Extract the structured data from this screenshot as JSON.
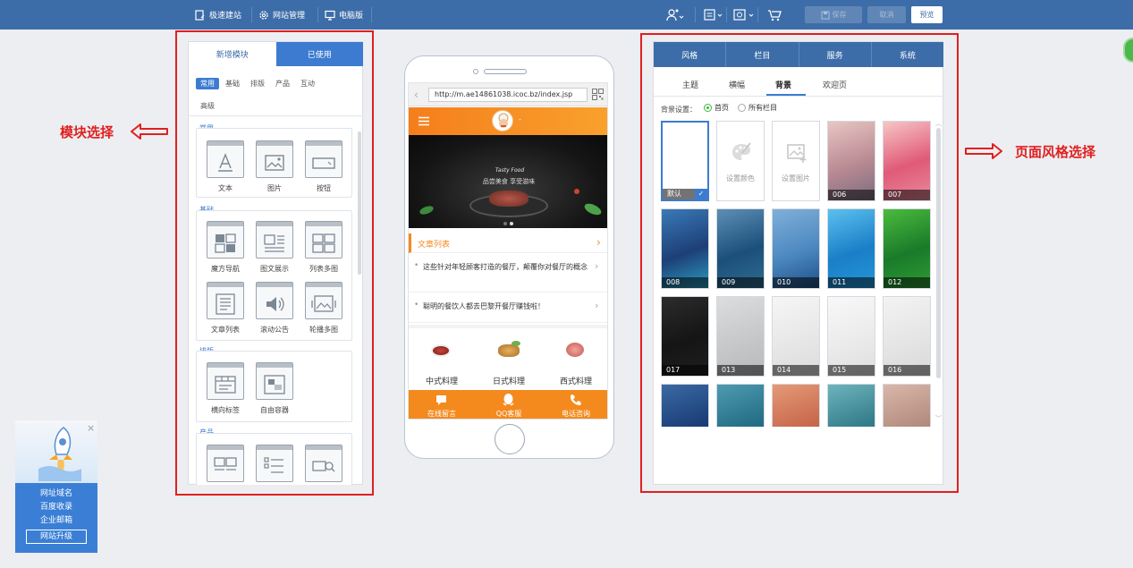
{
  "topbar": {
    "left_items": [
      {
        "label": "极速建站",
        "icon": "quick-build-icon"
      },
      {
        "label": "网站管理",
        "icon": "gear-icon"
      },
      {
        "label": "电脑版",
        "icon": "monitor-icon"
      }
    ],
    "save_label": "保存",
    "cancel_label": "取消",
    "preview_label": "预览",
    "bg": "#3d6da8"
  },
  "left_panel": {
    "tabs": [
      "新增模块",
      "已使用"
    ],
    "active_tab": 0,
    "categories": [
      "常用",
      "基础",
      "排版",
      "产品",
      "互动",
      "高级"
    ],
    "groups": [
      {
        "title": "常用",
        "modules": [
          "文本",
          "图片",
          "按钮"
        ]
      },
      {
        "title": "基础",
        "modules": [
          "魔方导航",
          "图文展示",
          "列表多图",
          "文章列表",
          "滚动公告",
          "轮播多图"
        ]
      },
      {
        "title": "排版",
        "modules": [
          "横向标签",
          "自由容器"
        ]
      },
      {
        "title": "产品",
        "modules": []
      }
    ]
  },
  "annotations": {
    "left": "模块选择",
    "right": "页面风格选择"
  },
  "phone": {
    "url": "http://m.ae14861038.icoc.bz/index.jsp",
    "header_suffix": "-",
    "banner_caption": "品尝美食 享受滋味",
    "article_title": "文章列表",
    "articles": [
      "这些针对年轻顾客打造的餐厅，颠覆你对餐厅的概念",
      "聪明的餐饮人都去巴黎开餐厅赚钱啦！"
    ],
    "cuisines": [
      "中式料理",
      "日式料理",
      "西式料理"
    ],
    "footer": [
      "在线留言",
      "QQ客服",
      "电话咨询"
    ],
    "accent": "#f48a1e"
  },
  "right_panel": {
    "tabs": [
      "风格",
      "栏目",
      "服务",
      "系统"
    ],
    "active_tab": 0,
    "subtabs": [
      "主题",
      "横幅",
      "背景",
      "欢迎页"
    ],
    "active_subtab": 2,
    "bg_setting_label": "背景设置：",
    "radio_options": [
      "首页",
      "所有栏目"
    ],
    "radio_selected": 0,
    "tiles": [
      {
        "label": "默认",
        "style": "plain",
        "selected": true
      },
      {
        "label": "设置颜色",
        "style": "palette"
      },
      {
        "label": "设置图片",
        "style": "image"
      },
      {
        "label": "006",
        "colors": [
          "#b98a93",
          "#e9c6c3",
          "#7a6c7e"
        ]
      },
      {
        "label": "007",
        "colors": [
          "#e05a78",
          "#f6c6c6",
          "#e88b9a"
        ]
      },
      {
        "label": "008",
        "colors": [
          "#1d3f77",
          "#3a7ab8",
          "#2a9cbf"
        ]
      },
      {
        "label": "009",
        "colors": [
          "#1c4f7a",
          "#5d8fb6",
          "#2f6c8f"
        ]
      },
      {
        "label": "010",
        "colors": [
          "#4c88c0",
          "#7fb0da",
          "#1d4f86"
        ]
      },
      {
        "label": "011",
        "colors": [
          "#1a7fc7",
          "#5cc0ef",
          "#2496d8"
        ]
      },
      {
        "label": "012",
        "colors": [
          "#1a7a2a",
          "#4bbb3d",
          "#2e9b35"
        ]
      },
      {
        "label": "017",
        "colors": [
          "#151515",
          "#2c2c2c",
          "#1f1f1f"
        ]
      },
      {
        "label": "013",
        "colors": [
          "#c6c8ca",
          "#dcdddf",
          "#b7b9bb"
        ]
      },
      {
        "label": "014",
        "colors": [
          "#e7e7e7",
          "#f6f6f6",
          "#dcdcdc"
        ]
      },
      {
        "label": "015",
        "colors": [
          "#ebebeb",
          "#f8f8f8",
          "#dedede"
        ]
      },
      {
        "label": "016",
        "colors": [
          "#e5e5e5",
          "#f3f3f3",
          "#d8d8d8"
        ]
      },
      {
        "label": "",
        "colors": [
          "#1b3e78",
          "#3b6aa3",
          "#14336a"
        ]
      },
      {
        "label": "",
        "colors": [
          "#246e86",
          "#4e9bb0",
          "#195e75"
        ]
      },
      {
        "label": "",
        "colors": [
          "#c8694d",
          "#e59a77",
          "#b6583e"
        ]
      },
      {
        "label": "",
        "colors": [
          "#347d8b",
          "#6eb4bd",
          "#2a6d7a"
        ]
      },
      {
        "label": "",
        "colors": [
          "#b48d7f",
          "#d9b7aa",
          "#a27b6e"
        ]
      }
    ]
  },
  "promo": {
    "lines": [
      "网址域名",
      "百度收录",
      "企业邮箱"
    ],
    "button": "网站升级"
  }
}
